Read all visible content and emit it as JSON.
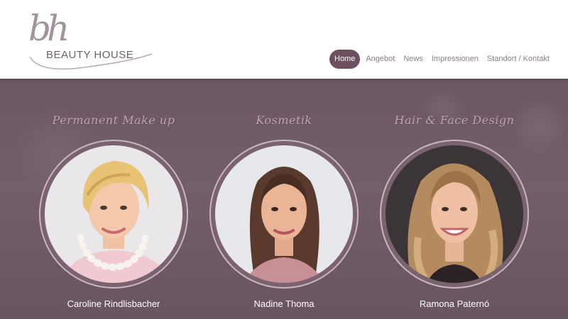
{
  "logo": {
    "mark": "bh",
    "text": "BEAUTY HOUSE"
  },
  "nav": {
    "items": [
      {
        "label": "Home",
        "active": true
      },
      {
        "label": "Angebot",
        "active": false
      },
      {
        "label": "News",
        "active": false
      },
      {
        "label": "Impressionen",
        "active": false
      },
      {
        "label": "Standort / Kontakt",
        "active": false
      }
    ]
  },
  "services": [
    {
      "title": "Permanent Make up",
      "name": "Caroline Rindlisbacher",
      "portrait": "blonde-woman-portrait"
    },
    {
      "title": "Kosmetik",
      "name": "Nadine Thoma",
      "portrait": "brunette-woman-portrait"
    },
    {
      "title": "Hair & Face Design",
      "name": "Ramona Paternó",
      "portrait": "curly-hair-woman-portrait"
    }
  ],
  "colors": {
    "accent": "#6e4f5f",
    "hero_bg": "#6e5864",
    "title_pink": "#bfa5b2",
    "ring": "#c9b6c0"
  }
}
